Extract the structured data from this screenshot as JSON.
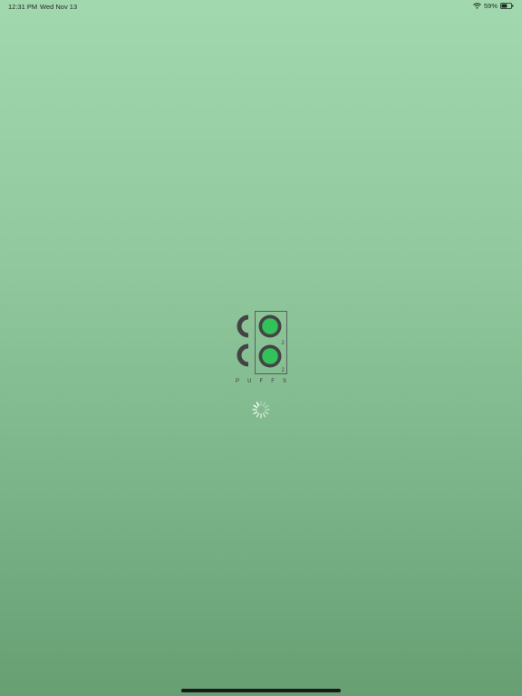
{
  "status_bar": {
    "time": "12:31 PM",
    "date": "Wed Nov 13",
    "battery_percent": "59%",
    "battery_level": 0.59,
    "wifi_icon": "wifi-icon",
    "battery_icon": "battery-icon"
  },
  "splash": {
    "logo_letters": [
      "C",
      "O",
      "C",
      "O"
    ],
    "subscript_1": "2",
    "subscript_2": "2",
    "tagline_letters": [
      "P",
      "U",
      "F",
      "F",
      "S"
    ],
    "spinner_icon": "activity-spinner-icon"
  },
  "colors": {
    "background_top": "#a2d8ae",
    "background_bottom": "#679f73",
    "logo_dark": "#444444",
    "logo_green": "#33c25a"
  }
}
